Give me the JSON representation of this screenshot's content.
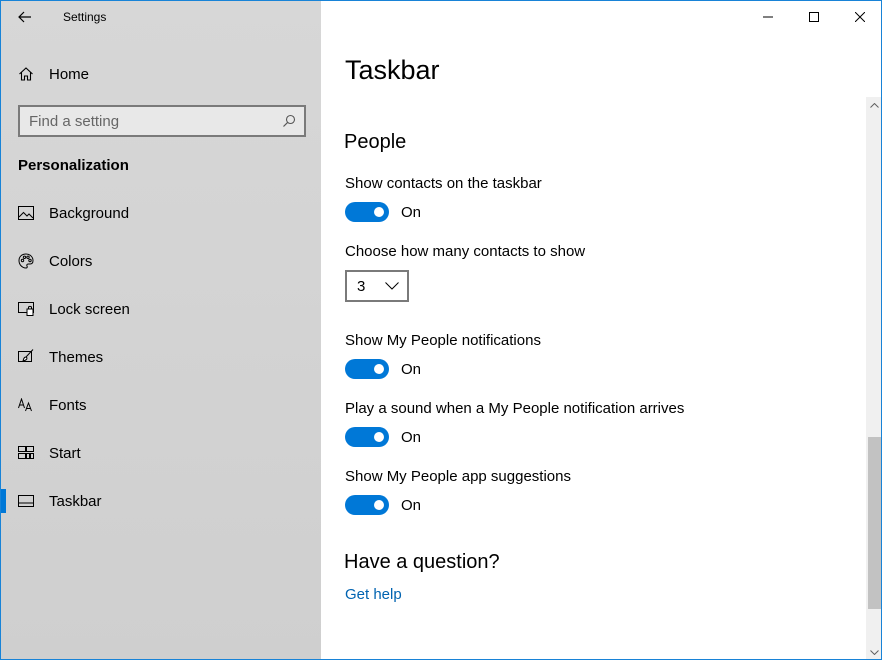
{
  "window": {
    "app_title": "Settings"
  },
  "sidebar": {
    "home_label": "Home",
    "search_placeholder": "Find a setting",
    "section_header": "Personalization",
    "items": [
      {
        "label": "Background",
        "icon": "picture-icon",
        "active": false
      },
      {
        "label": "Colors",
        "icon": "palette-icon",
        "active": false
      },
      {
        "label": "Lock screen",
        "icon": "lock-screen-icon",
        "active": false
      },
      {
        "label": "Themes",
        "icon": "brush-icon",
        "active": false
      },
      {
        "label": "Fonts",
        "icon": "fonts-icon",
        "active": false
      },
      {
        "label": "Start",
        "icon": "start-tiles-icon",
        "active": false
      },
      {
        "label": "Taskbar",
        "icon": "taskbar-icon",
        "active": true
      }
    ]
  },
  "main": {
    "page_title": "Taskbar",
    "people": {
      "heading": "People",
      "show_contacts": {
        "label": "Show contacts on the taskbar",
        "state": "On"
      },
      "contacts_count": {
        "label": "Choose how many contacts to show",
        "value": "3"
      },
      "notifications": {
        "label": "Show My People notifications",
        "state": "On"
      },
      "sound": {
        "label": "Play a sound when a My People notification arrives",
        "state": "On"
      },
      "suggestions": {
        "label": "Show My People app suggestions",
        "state": "On"
      }
    },
    "question": {
      "heading": "Have a question?",
      "link": "Get help"
    }
  },
  "colors": {
    "accent": "#0078d7",
    "link": "#0063b1",
    "sidebar_bg": "#d3d3d3"
  }
}
